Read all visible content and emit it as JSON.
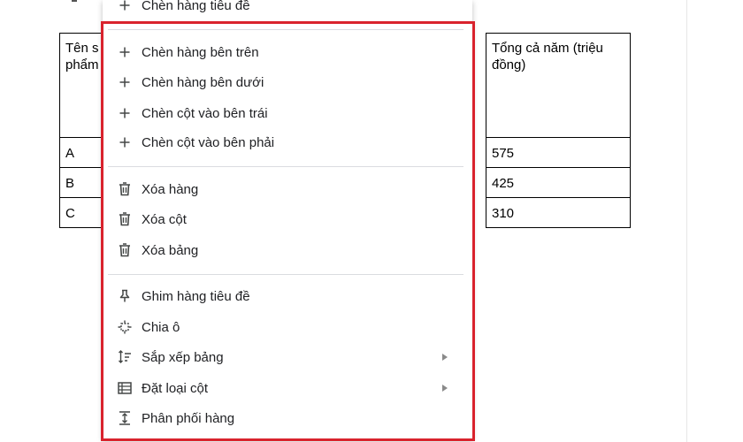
{
  "document": {
    "table": {
      "left_column": {
        "header": "Tên s\nphẩm",
        "rows": [
          "A",
          "B",
          "C"
        ]
      },
      "right_column": {
        "header": "Tổng cả năm (triệu đồng)",
        "rows": [
          "575",
          "425",
          "310"
        ]
      }
    }
  },
  "context_menu": {
    "top_item": {
      "label": "Chèn hàng tiêu đề",
      "icon": "plus-icon"
    },
    "insert_group": [
      {
        "label": "Chèn hàng bên trên",
        "icon": "plus-icon"
      },
      {
        "label": "Chèn hàng bên dưới",
        "icon": "plus-icon"
      },
      {
        "label": "Chèn cột vào bên trái",
        "icon": "plus-icon"
      },
      {
        "label": "Chèn cột vào bên phải",
        "icon": "plus-icon"
      }
    ],
    "delete_group": [
      {
        "label": "Xóa hàng",
        "icon": "trash-icon"
      },
      {
        "label": "Xóa cột",
        "icon": "trash-icon"
      },
      {
        "label": "Xóa bảng",
        "icon": "trash-icon"
      }
    ],
    "table_group": [
      {
        "label": "Ghim hàng tiêu đề",
        "icon": "pin-icon"
      },
      {
        "label": "Chia ô",
        "icon": "split-cell-icon"
      },
      {
        "label": "Sắp xếp bảng",
        "icon": "sort-icon",
        "submenu": true
      },
      {
        "label": "Đặt loại cột",
        "icon": "column-type-icon",
        "submenu": true
      },
      {
        "label": "Phân phối hàng",
        "icon": "distribute-rows-icon"
      }
    ]
  },
  "colors": {
    "highlight_frame": "#d9232d",
    "menu_text": "#202124",
    "icon": "#444746",
    "divider": "#dadce0"
  }
}
